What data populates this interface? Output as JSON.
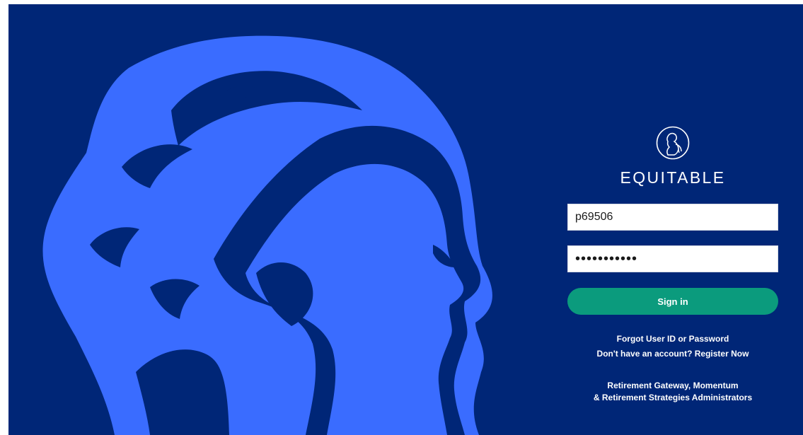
{
  "colors": {
    "background": "#002677",
    "art_accent": "#3a6cff",
    "button": "#0b9b7d",
    "text": "#ffffff"
  },
  "brand": {
    "name": "EQUITABLE",
    "seal_icon": "equitable-seal-icon"
  },
  "login": {
    "user_id_value": "p69506",
    "password_value": "Password123"
  },
  "signin_label": "Sign in",
  "links": {
    "forgot": "Forgot User ID or Password",
    "register": "Don't have an account? Register Now"
  },
  "products": {
    "line1": "Retirement Gateway, Momentum",
    "line2": "& Retirement Strategies Administrators"
  }
}
